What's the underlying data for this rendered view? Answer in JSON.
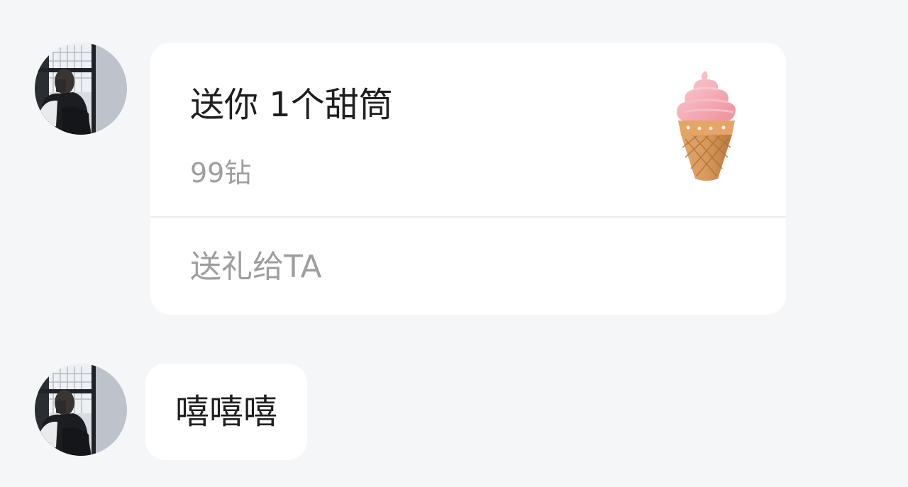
{
  "messages": [
    {
      "type": "gift",
      "avatar_icon": "user-avatar-photo",
      "gift": {
        "title": "送你 1个甜筒",
        "price": "99钻",
        "action_label": "送礼给TA",
        "image_icon": "ice-cream-cone-icon"
      }
    },
    {
      "type": "text",
      "avatar_icon": "user-avatar-photo",
      "text": "嘻嘻嘻"
    }
  ],
  "colors": {
    "background": "#f5f6f8",
    "bubble": "#ffffff",
    "primary_text": "#1f1f1f",
    "secondary_text": "#9e9e9e",
    "divider": "#ececec",
    "ice_cream_pink": "#f4a3ae",
    "cone": "#d39558"
  }
}
